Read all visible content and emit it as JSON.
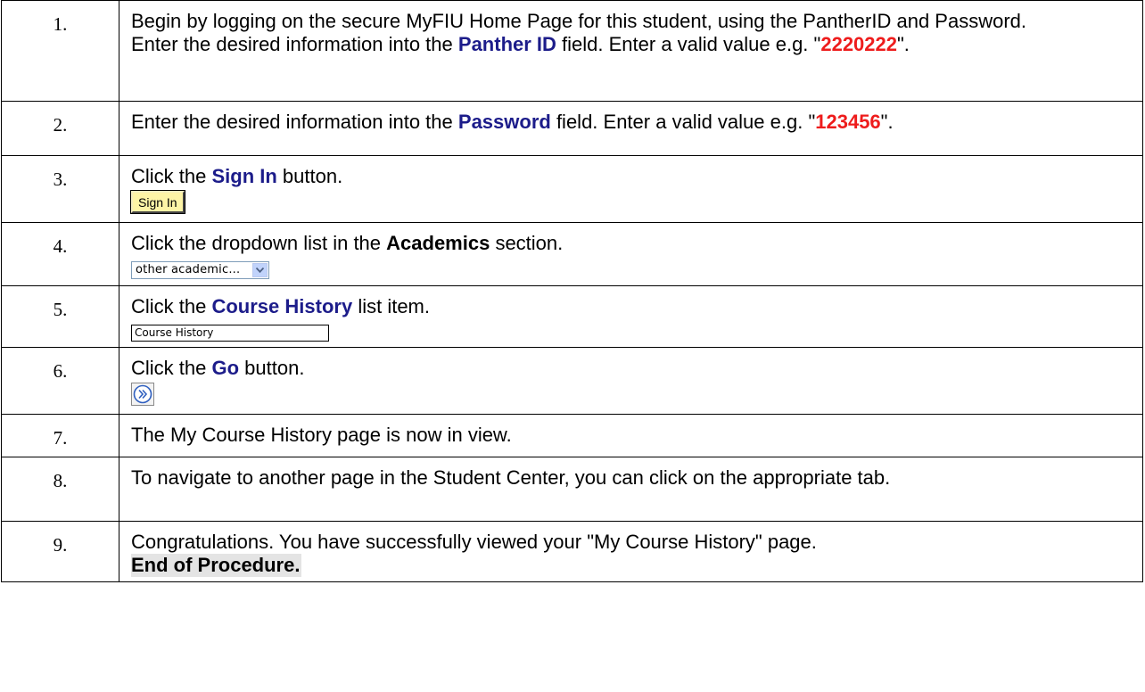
{
  "steps": [
    {
      "num": "1.",
      "line1": "Begin by logging on the secure MyFIU Home Page for this student, using the PantherID and Password.",
      "line2_pre": "Enter the desired information into the ",
      "line2_kw": "Panther ID",
      "line2_post": " field. Enter a valid value e.g. \"",
      "line2_val": "2220222",
      "line2_end": "\"."
    },
    {
      "num": "2.",
      "pre": "Enter the desired information into the ",
      "kw": "Password",
      "post": " field. Enter a valid value e.g. \"",
      "val": "123456",
      "end": "\"."
    },
    {
      "num": "3.",
      "pre": "Click the ",
      "kw": "Sign In",
      "post": " button.",
      "button_label": "Sign In"
    },
    {
      "num": "4.",
      "pre": "Click the dropdown list in the ",
      "kw": "Academics",
      "post": " section.",
      "dropdown_value": "other academic..."
    },
    {
      "num": "5.",
      "pre": "Click the ",
      "kw": "Course History",
      "post": " list item.",
      "list_item": "Course History"
    },
    {
      "num": "6.",
      "pre": "Click the ",
      "kw": "Go",
      "post": " button."
    },
    {
      "num": "7.",
      "text": "The My Course History page is now in view."
    },
    {
      "num": "8.",
      "text": "To navigate to another page in the Student Center, you can click on the appropriate tab."
    },
    {
      "num": "9.",
      "text": "Congratulations. You have successfully viewed your \"My Course History\" page.",
      "end_label": "End of Procedure."
    }
  ],
  "colors": {
    "keyword": "#1c1c8a",
    "value": "#ee1c1c",
    "signin_bg": "#fdf4a6"
  }
}
